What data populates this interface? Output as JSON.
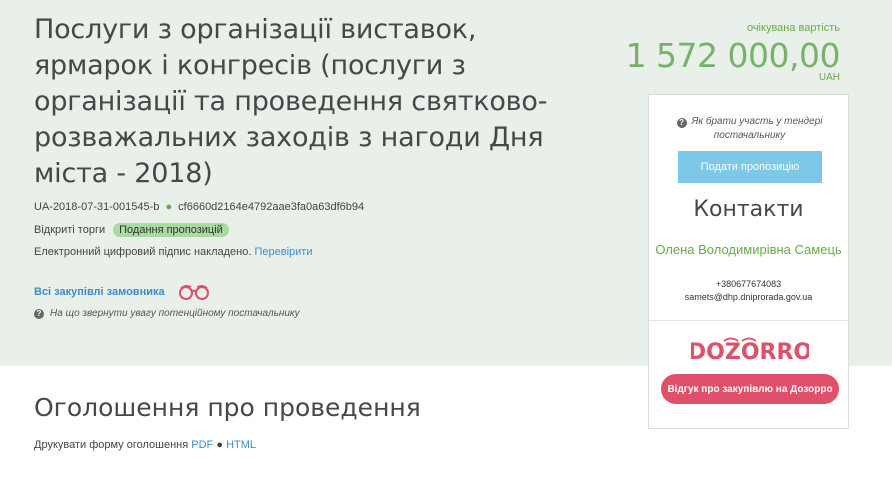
{
  "tender": {
    "title": "Послуги з організації виставок, ярмарок і конгресів (послуги з організації та проведення святково-розважальних заходів з нагоди Дня міста - 2018)",
    "id": "UA-2018-07-31-001545-b",
    "hash": "cf6660d2164e4792aae3fa0a63df6b94",
    "procedure": "Відкриті торги",
    "status": "Подання пропозицій",
    "signature_text": "Електронний цифровий підпис накладено.",
    "signature_link": "Перевірити",
    "all_purchases_link": "Всі закупівлі замовника",
    "attention_text": "На що звернути увагу потенційному постачальнику"
  },
  "price": {
    "caption": "очікувана вартість",
    "value": "1 572 000,00",
    "currency": "UAH"
  },
  "sidebar": {
    "how_to_text": "Як брати участь у тендері постачальнику",
    "submit_button": "Подати пропозицію",
    "contacts_title": "Контакти",
    "contact_name": "Олена Володимирівна Самець",
    "contact_phone": "+380677674083",
    "contact_email": "samets@dhp.dniprorada.gov.ua",
    "dozorro_logo": "DOZORRO",
    "feedback_button": "Відгук про закупівлю на Дозорро"
  },
  "announcement": {
    "title": "Оголошення про проведення",
    "print_label": "Друкувати форму оголошення",
    "pdf_link": "PDF",
    "separator": "●",
    "html_link": "HTML"
  },
  "colors": {
    "band_bg": "#e9efe9",
    "accent_green": "#77b26a",
    "link_blue": "#3d8cc7",
    "submit_blue": "#7cc8e8",
    "dozorro_red": "#e0506a"
  },
  "icons": {
    "question": "question-circle-icon",
    "dozorro_eyes": "dozorro-eyes-icon"
  }
}
